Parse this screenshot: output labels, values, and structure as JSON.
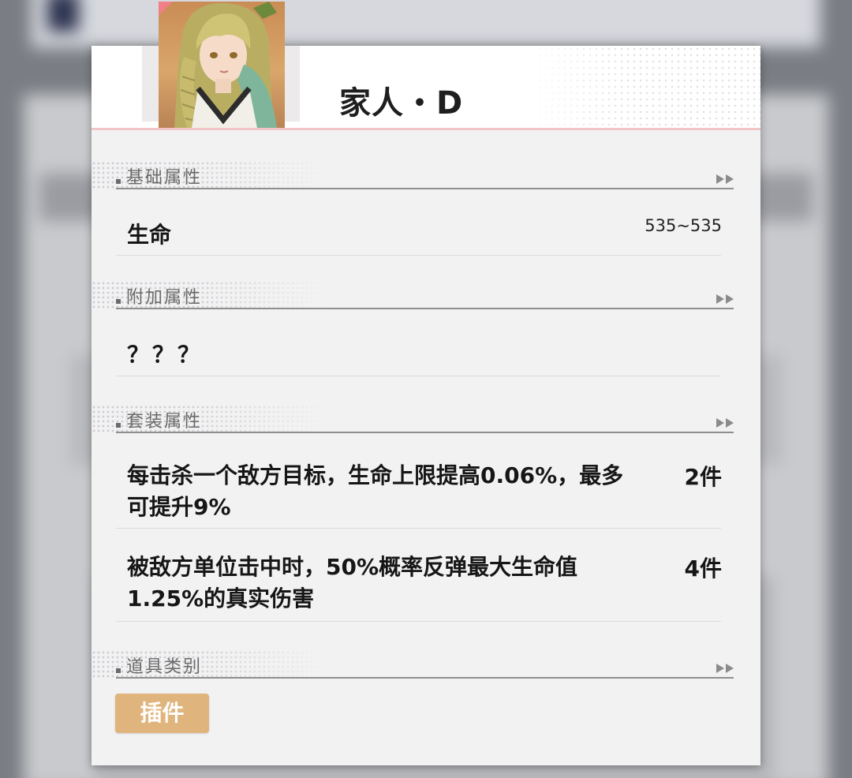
{
  "item": {
    "name": "家人・D",
    "portrait": "green-haired braided character portrait"
  },
  "sections": {
    "base": {
      "title": "基础属性",
      "stat_label": "生命",
      "stat_value": "535~535"
    },
    "extra": {
      "title": "附加属性",
      "stat_label": "？？？"
    },
    "set": {
      "title": "套装属性",
      "effects": [
        {
          "text": "每击杀一个敌方目标，生命上限提高0.06%，最多可提升9%",
          "count": "2件"
        },
        {
          "text": "被敌方单位击中时，50%概率反弹最大生命值1.25%的真实伤害",
          "count": "4件"
        }
      ]
    },
    "type": {
      "title": "道具类别",
      "tag": "插件"
    }
  },
  "icons": {
    "section_arrow": "double-chevron-right-icon"
  },
  "colors": {
    "tag_background": "#e0b57d",
    "header_accent": "#f2c6c6",
    "portrait_corner": "#f07f86"
  }
}
